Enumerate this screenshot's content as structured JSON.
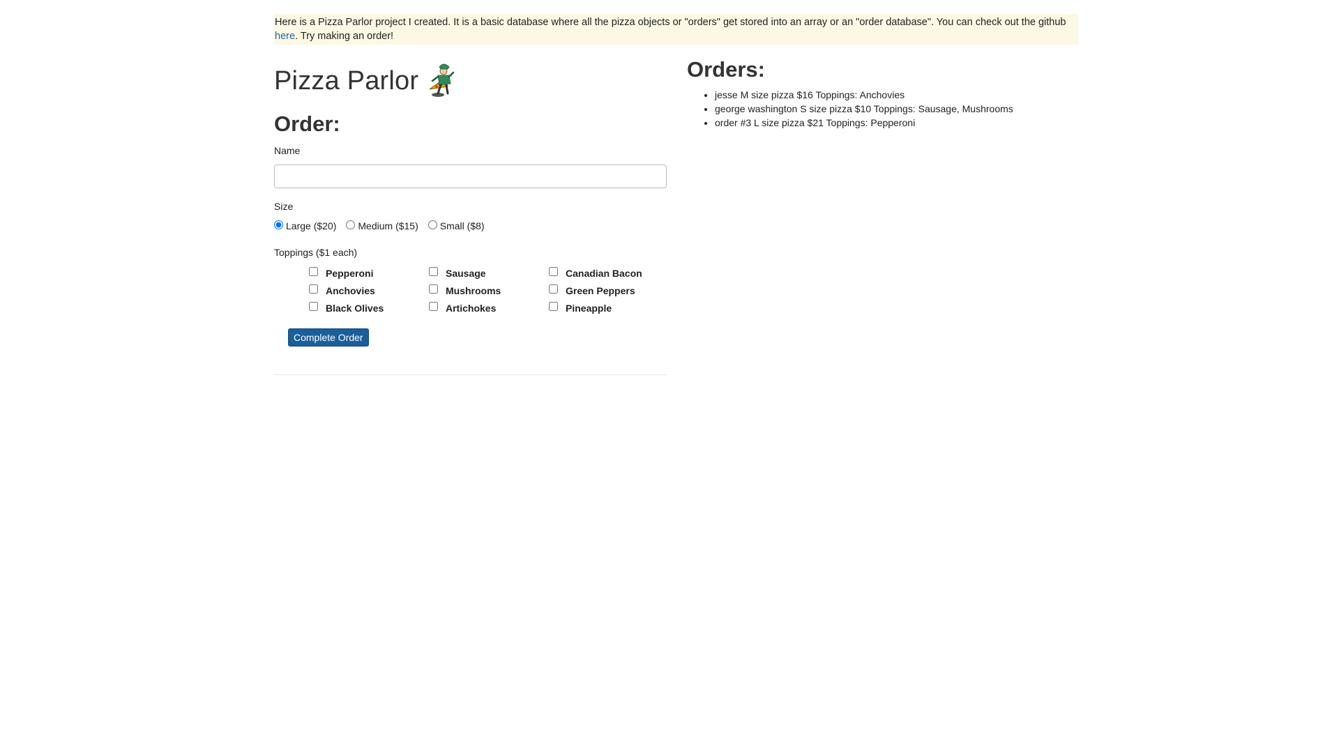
{
  "intro": {
    "text_before_link": "Here is a Pizza Parlor project I created. It is a basic database where all the pizza objects or \"orders\" get stored into an array or an \"order database\". You can check out the github ",
    "link_text": "here",
    "text_after_link": ". Try making an order!",
    "background_color": "#fcf8e3",
    "link_color": "#1a6aa8"
  },
  "header": {
    "title": "Pizza Parlor",
    "logo_icon": "pizza-chef-icon"
  },
  "order_form": {
    "heading": "Order:",
    "name_label": "Name",
    "name_value": "",
    "size_label": "Size",
    "sizes": [
      {
        "label": "Large ($20)",
        "checked": true
      },
      {
        "label": "Medium ($15)",
        "checked": false
      },
      {
        "label": "Small ($8)",
        "checked": false
      }
    ],
    "toppings_label": "Toppings ($1 each)",
    "toppings": [
      {
        "label": "Pepperoni",
        "checked": false
      },
      {
        "label": "Sausage",
        "checked": false
      },
      {
        "label": "Canadian Bacon",
        "checked": false
      },
      {
        "label": "Anchovies",
        "checked": false
      },
      {
        "label": "Mushrooms",
        "checked": false
      },
      {
        "label": "Green Peppers",
        "checked": false
      },
      {
        "label": "Black Olives",
        "checked": false
      },
      {
        "label": "Artichokes",
        "checked": false
      },
      {
        "label": "Pineapple",
        "checked": false
      }
    ],
    "submit_label": "Complete Order",
    "submit_color": "#1a5e9a"
  },
  "orders": {
    "heading": "Orders:",
    "items": [
      "jesse M size pizza $16 Toppings: Anchovies",
      "george washington S size pizza $10 Toppings: Sausage, Mushrooms",
      "order #3 L size pizza $21 Toppings: Pepperoni"
    ]
  }
}
